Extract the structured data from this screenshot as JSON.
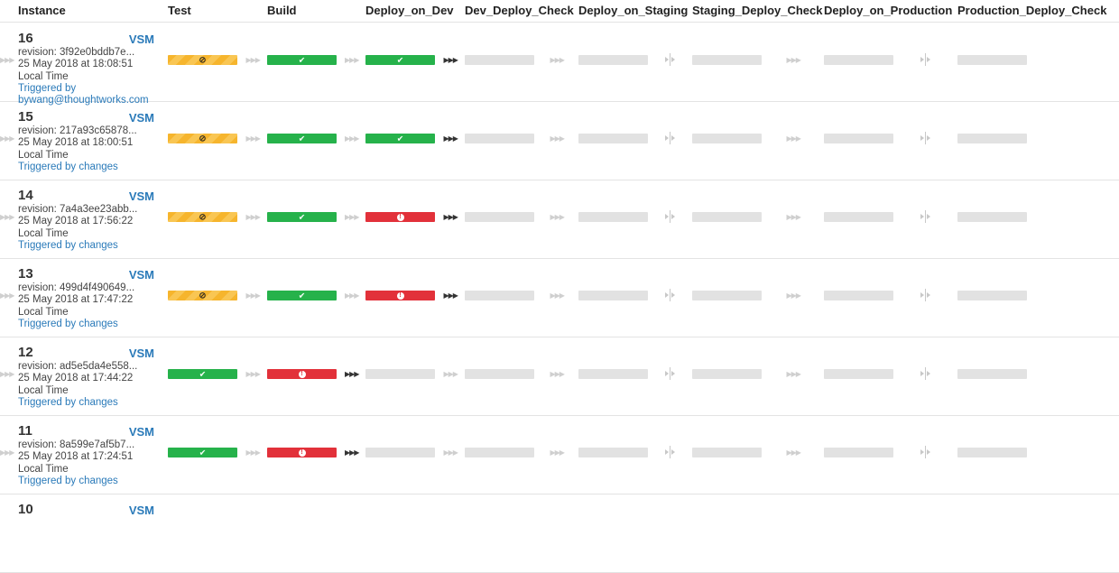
{
  "columns": [
    "Instance",
    "Test",
    "Build",
    "Deploy_on_Dev",
    "Dev_Deploy_Check",
    "Deploy_on_Staging",
    "Staging_Deploy_Check",
    "Deploy_on_Production",
    "Production_Deploy_Check"
  ],
  "vsm_label": "VSM",
  "status_colors": {
    "passed": "#26b24b",
    "failed": "#e2313a",
    "cancelled": "#f6b52d",
    "unknown": "#e2e2e2",
    "link": "#2a7ab9"
  },
  "icons": {
    "passed": "check-icon",
    "failed": "exclamation-icon",
    "cancelled": "ban-icon",
    "connector": "triple-arrow-icon",
    "manual_gate": "manual-gate-icon"
  },
  "connectors": [
    "auto",
    "auto",
    "auto",
    "auto",
    "manual",
    "auto",
    "manual",
    "auto"
  ],
  "instances": [
    {
      "counter": "16",
      "revision": "revision: 3f92e0bddb7e...",
      "date": "25 May 2018 at 18:08:51",
      "local_time": "Local Time",
      "triggered": "Triggered by",
      "triggered_user": "bywang@thoughtworks.com",
      "stages": [
        "cancelled",
        "passed",
        "passed",
        "unknown",
        "unknown",
        "unknown",
        "unknown",
        "unknown"
      ]
    },
    {
      "counter": "15",
      "revision": "revision: 217a93c65878...",
      "date": "25 May 2018 at 18:00:51",
      "local_time": "Local Time",
      "triggered": "Triggered by changes",
      "stages": [
        "cancelled",
        "passed",
        "passed",
        "unknown",
        "unknown",
        "unknown",
        "unknown",
        "unknown"
      ]
    },
    {
      "counter": "14",
      "revision": "revision: 7a4a3ee23abb...",
      "date": "25 May 2018 at 17:56:22",
      "local_time": "Local Time",
      "triggered": "Triggered by changes",
      "stages": [
        "cancelled",
        "passed",
        "failed",
        "unknown",
        "unknown",
        "unknown",
        "unknown",
        "unknown"
      ]
    },
    {
      "counter": "13",
      "revision": "revision: 499d4f490649...",
      "date": "25 May 2018 at 17:47:22",
      "local_time": "Local Time",
      "triggered": "Triggered by changes",
      "stages": [
        "cancelled",
        "passed",
        "failed",
        "unknown",
        "unknown",
        "unknown",
        "unknown",
        "unknown"
      ]
    },
    {
      "counter": "12",
      "revision": "revision: ad5e5da4e558...",
      "date": "25 May 2018 at 17:44:22",
      "local_time": "Local Time",
      "triggered": "Triggered by changes",
      "stages": [
        "passed",
        "failed",
        "unknown",
        "unknown",
        "unknown",
        "unknown",
        "unknown",
        "unknown"
      ]
    },
    {
      "counter": "11",
      "revision": "revision: 8a599e7af5b7...",
      "date": "25 May 2018 at 17:24:51",
      "local_time": "Local Time",
      "triggered": "Triggered by changes",
      "stages": [
        "passed",
        "failed",
        "unknown",
        "unknown",
        "unknown",
        "unknown",
        "unknown",
        "unknown"
      ]
    },
    {
      "counter": "10",
      "revision": "",
      "date": "",
      "local_time": "",
      "triggered": "",
      "stages": []
    }
  ]
}
